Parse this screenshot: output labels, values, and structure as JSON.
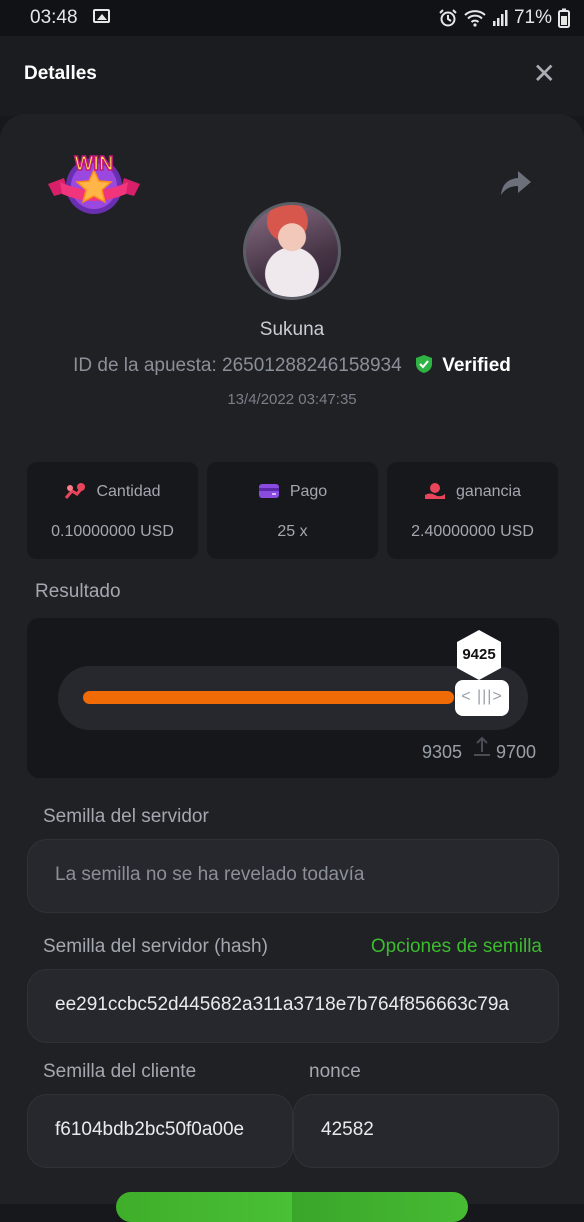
{
  "status_bar": {
    "time": "03:48",
    "battery": "71%"
  },
  "header": {
    "title": "Detalles",
    "close_icon": "close-icon"
  },
  "bet": {
    "username": "Sukuna",
    "id_label": "ID de la apuesta:",
    "id_value": "26501288246158934",
    "verified_label": "Verified",
    "date": "13/4/2022 03:47:35",
    "badge_text": "WIN"
  },
  "stats": [
    {
      "label": "Cantidad",
      "value": "0.10000000 USD",
      "icon": "coins-icon",
      "color": "#e8445a"
    },
    {
      "label": "Pago",
      "value": "25 x",
      "icon": "card-icon",
      "color": "#8a4be0"
    },
    {
      "label": "ganancia",
      "value": "2.40000000 USD",
      "icon": "hand-coin-icon",
      "color": "#e8445a"
    }
  ],
  "result": {
    "label": "Resultado",
    "value": "9425",
    "target": "9305",
    "max": "9700",
    "fill_fraction": 0.79,
    "accent": "#f06a06"
  },
  "seeds": {
    "server_label": "Semilla del servidor",
    "server_placeholder": "La semilla no se ha revelado todavía",
    "server_hash_label": "Semilla del servidor (hash)",
    "seed_options_link": "Opciones de semilla",
    "server_hash_value": "ee291ccbc52d445682a311a3718e7b764f856663c79a",
    "client_label": "Semilla del cliente",
    "client_value": "f6104bdb2bc50f0a00e",
    "nonce_label": "nonce",
    "nonce_value": "42582"
  }
}
